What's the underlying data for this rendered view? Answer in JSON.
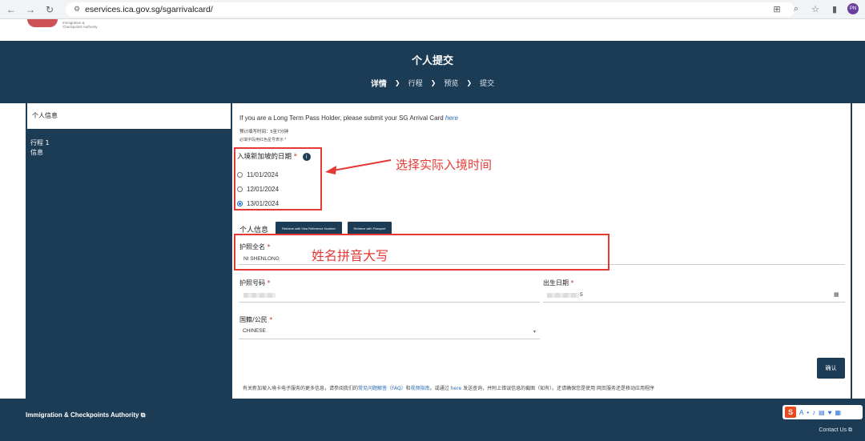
{
  "browser": {
    "url": "eservices.ica.gov.sg/sgarrivalcard/",
    "avatar_text": "PN"
  },
  "header": {
    "title": "个人提交",
    "steps": [
      "详情",
      "行程",
      "预览",
      "提交"
    ]
  },
  "sidebar": {
    "active_item": "个人信息",
    "items": [
      "行程 1",
      "信息"
    ]
  },
  "content": {
    "lt_note_text": "If you are a Long Term Pass Holder, please submit your SG Arrival Card",
    "lt_note_link": "here",
    "time_note": "预计填写时间：5至7分钟",
    "required_note": "必填字段用红色星号表示 *",
    "arrival_label": "入境新加坡的日期",
    "arrival_options": [
      "11/01/2024",
      "12/01/2024",
      "13/01/2024"
    ],
    "arrival_selected_index": 2,
    "section_title": "个人信息",
    "retrieve_visa_label": "Retrieve with Visa Reference Number",
    "retrieve_passport_label": "Retrieve with Passport",
    "fullname_label": "护照全名",
    "fullname_value": "NI SHENLONG",
    "passport_label": "护照号码",
    "dob_label": "出生日期",
    "dob_value_visible": "5",
    "nationality_label": "国籍/公民",
    "nationality_value": "CHINESE",
    "confirm_label": "确认",
    "help_text_before": "有关新加坡入境卡电子服务的更多信息，请参阅我们的",
    "help_faq": "常见问题解答（FAQ）",
    "help_and": "和",
    "help_video": "视频指南",
    "help_mid": "。或通过",
    "help_here": "here",
    "help_after": "发送查询，并附上错误信息的截图（如有）。还请确保您是使用 网页服务还是移动应用程序",
    "required_star": "*"
  },
  "annotations": {
    "date_hint": "选择实际入境时间",
    "name_hint": "姓名拼音大写",
    "highlight_color": "#e53935"
  },
  "footer": {
    "authority": "Immigration & Checkpoints Authority",
    "contact": "Contact Us"
  },
  "colors": {
    "brand_dark": "#1c3b55",
    "link": "#2b6cb0",
    "required": "#c0392b"
  }
}
